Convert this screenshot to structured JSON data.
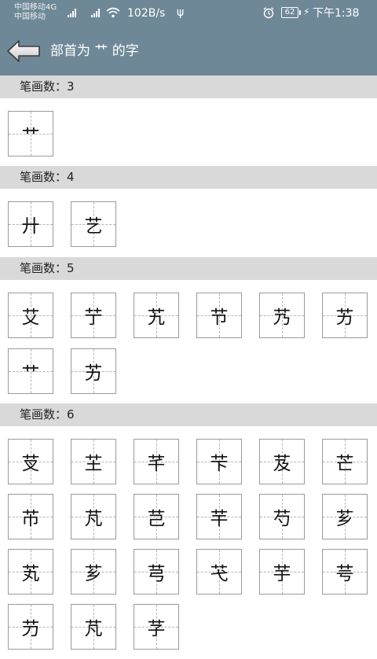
{
  "status_bar": {
    "carrier_line1": "中国移动4G",
    "carrier_line2": "中国移动",
    "network_label": "4G",
    "net_speed": "102B/s",
    "battery_level": "62",
    "time": "下午1:38"
  },
  "header": {
    "title": "部首为 艹 的字"
  },
  "sections": [
    {
      "label": "笔画数：3",
      "chars": [
        "艹"
      ]
    },
    {
      "label": "笔画数：4",
      "chars": [
        "廾",
        "艺"
      ]
    },
    {
      "label": "笔画数：5",
      "chars": [
        "艾",
        "艼",
        "艽",
        "节",
        "艿",
        "艻",
        "艹",
        "艻"
      ]
    },
    {
      "label": "笔画数：6",
      "chars": [
        "芆",
        "芏",
        "芊",
        "芐",
        "芨",
        "芒",
        "芇",
        "芃",
        "芑",
        "芉",
        "芍",
        "芗",
        "芄",
        "芗",
        "芎",
        "芅",
        "芋",
        "芌",
        "芀",
        "芃",
        "芓"
      ]
    }
  ]
}
